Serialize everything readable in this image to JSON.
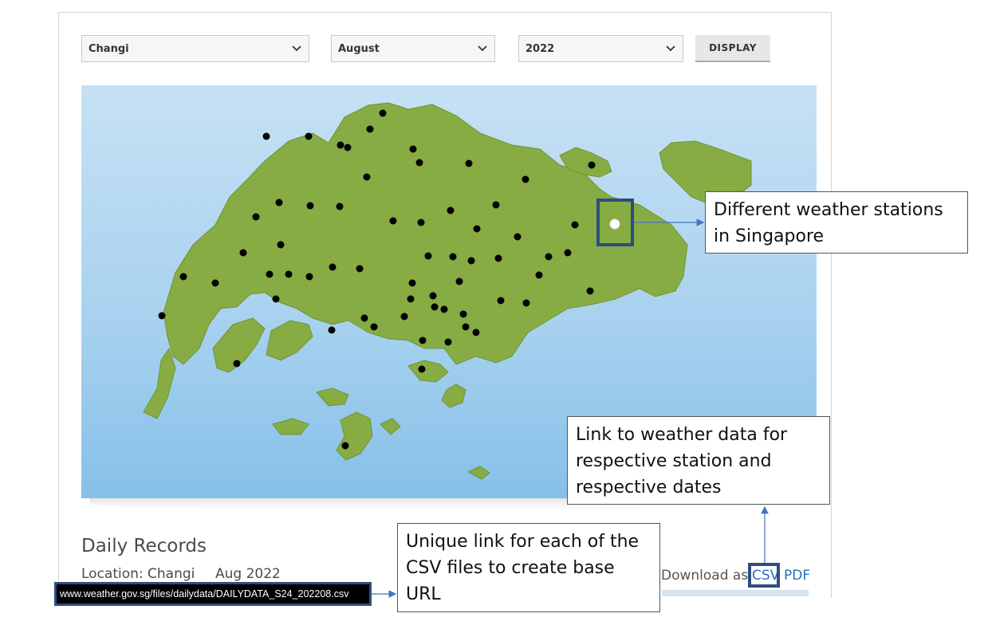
{
  "filters": {
    "station": "Changi",
    "month": "August",
    "year": "2022",
    "display_label": "DISPLAY"
  },
  "records": {
    "heading": "Daily Records",
    "location": "Location: Changi",
    "period": "Aug 2022",
    "download_label": "Download as:",
    "csv_label": "CSV",
    "pdf_label": "PDF"
  },
  "status_url": "www.weather.gov.sg/files/dailydata/DAILYDATA_S24_202208.csv",
  "annotations": {
    "stations_line1": "Different weather stations",
    "stations_line2": "in Singapore",
    "link_line1": "Link to weather data for",
    "link_line2": "respective station and",
    "link_line3": "respective dates",
    "unique_line1": "Unique link for each of the",
    "unique_line2": "CSV files to create base",
    "unique_line3": "URL"
  },
  "colors": {
    "land": "#86ac43",
    "sea": "#a9d2ef",
    "station_dot": "#000000",
    "selected_station_dot": "#ffffff",
    "highlight_border": "#2f4d7e",
    "arrow": "#4472c4",
    "link": "#2a6fbd"
  },
  "icons": {
    "dropdown": "chevron-down-icon"
  }
}
